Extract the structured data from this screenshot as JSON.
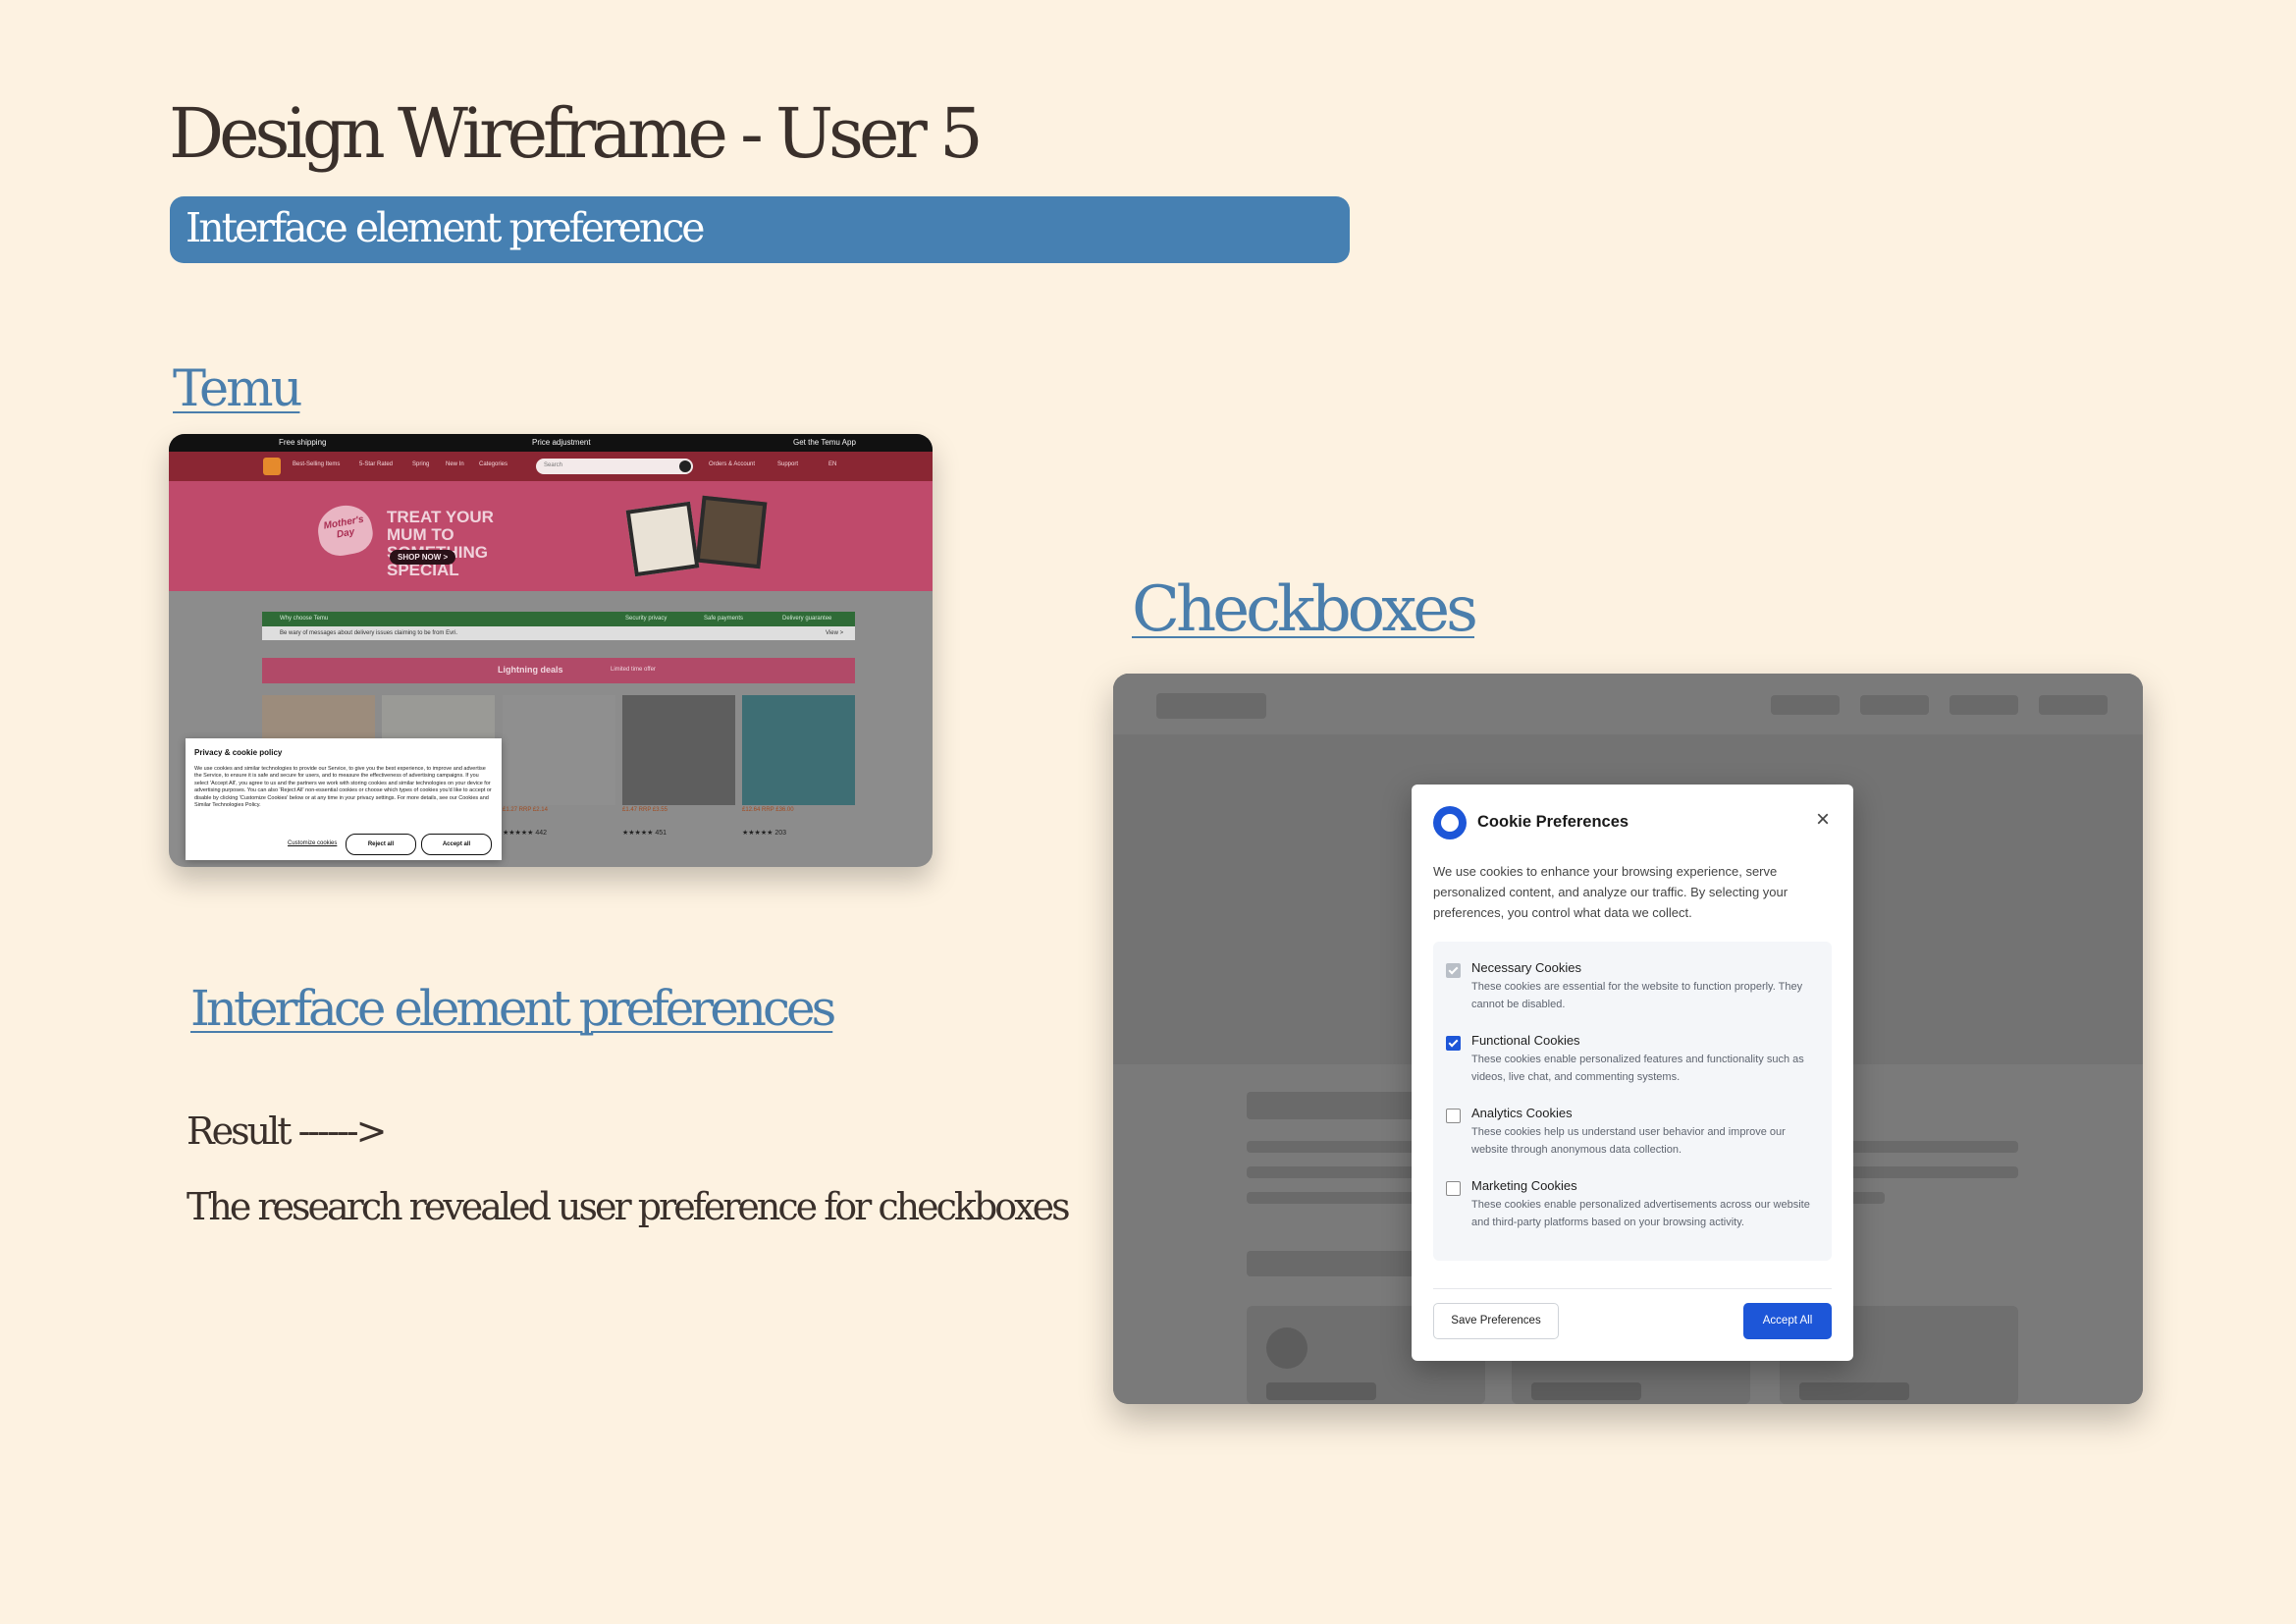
{
  "header": {
    "title": "Design Wireframe - User 5",
    "subtitle": "Interface element preference"
  },
  "sections": {
    "temu_label": "Temu",
    "checkbox_label": "Checkboxes",
    "prefs_label": "Interface element preferences",
    "result": "Result ------>",
    "research": "The research revealed user preference for checkboxes"
  },
  "temu": {
    "topbar": [
      "Free shipping",
      "Price adjustment",
      "Get the Temu App"
    ],
    "nav": [
      "Best-Selling Items",
      "5-Star Rated",
      "Spring",
      "New In",
      "Categories",
      "Orders & Account",
      "Support",
      "EN"
    ],
    "search_placeholder": "Search",
    "hero_badge": "Mother's Day",
    "hero_title": "TREAT YOUR MUM TO SOMETHING SPECIAL",
    "hero_cta": "SHOP NOW >",
    "strip_why": "Why choose Temu",
    "strip_security": "Security privacy",
    "strip_payments": "Safe payments",
    "strip_delivery": "Delivery guarantee",
    "strip_notice": "Be wary of messages about delivery issues claiming to be from Evri.",
    "strip_view": "View >",
    "lightning": "Lightning deals",
    "lightning_sub": "Limited time offer",
    "prices": [
      "£1.27 RRP £2.14",
      "£1.47 RRP £3.55",
      "£12.64 RRP £36.00"
    ],
    "stars": [
      "★★★★★ 442",
      "★★★★★ 451",
      "★★★★★ 203"
    ],
    "cookie": {
      "title": "Privacy & cookie policy",
      "body": "We use cookies and similar technologies to provide our Service, to give you the best experience, to improve and advertise the Service, to ensure it is safe and secure for users, and to measure the effectiveness of advertising campaigns. If you select 'Accept All', you agree to us and the partners we work with storing cookies and similar technologies on your device for advertising purposes. You can also 'Reject All' non-essential cookies or choose which types of cookies you'd like to accept or disable by clicking 'Customize Cookies' below or at any time in your privacy settings. For more details, see our Cookies and Similar Technologies Policy.",
      "customize": "Customize cookies",
      "reject": "Reject all",
      "accept": "Accept all"
    }
  },
  "cookie_modal": {
    "title": "Cookie Preferences",
    "close": "×",
    "description": "We use cookies to enhance your browsing experience, serve personalized content, and analyze our traffic. By selecting your preferences, you control what data we collect.",
    "options": [
      {
        "title": "Necessary Cookies",
        "description": "These cookies are essential for the website to function properly. They cannot be disabled.",
        "state": "checked-disabled"
      },
      {
        "title": "Functional Cookies",
        "description": "These cookies enable personalized features and functionality such as videos, live chat, and commenting systems.",
        "state": "checked"
      },
      {
        "title": "Analytics Cookies",
        "description": "These cookies help us understand user behavior and improve our website through anonymous data collection.",
        "state": "unchecked"
      },
      {
        "title": "Marketing Cookies",
        "description": "These cookies enable personalized advertisements across our website and third-party platforms based on your browsing activity.",
        "state": "unchecked"
      }
    ],
    "save_button": "Save Preferences",
    "accept_button": "Accept All"
  },
  "colors": {
    "page_bg": "#fdf2e1",
    "banner": "#4680b2",
    "link": "#4a7eac",
    "accent_blue": "#1d56d8"
  }
}
